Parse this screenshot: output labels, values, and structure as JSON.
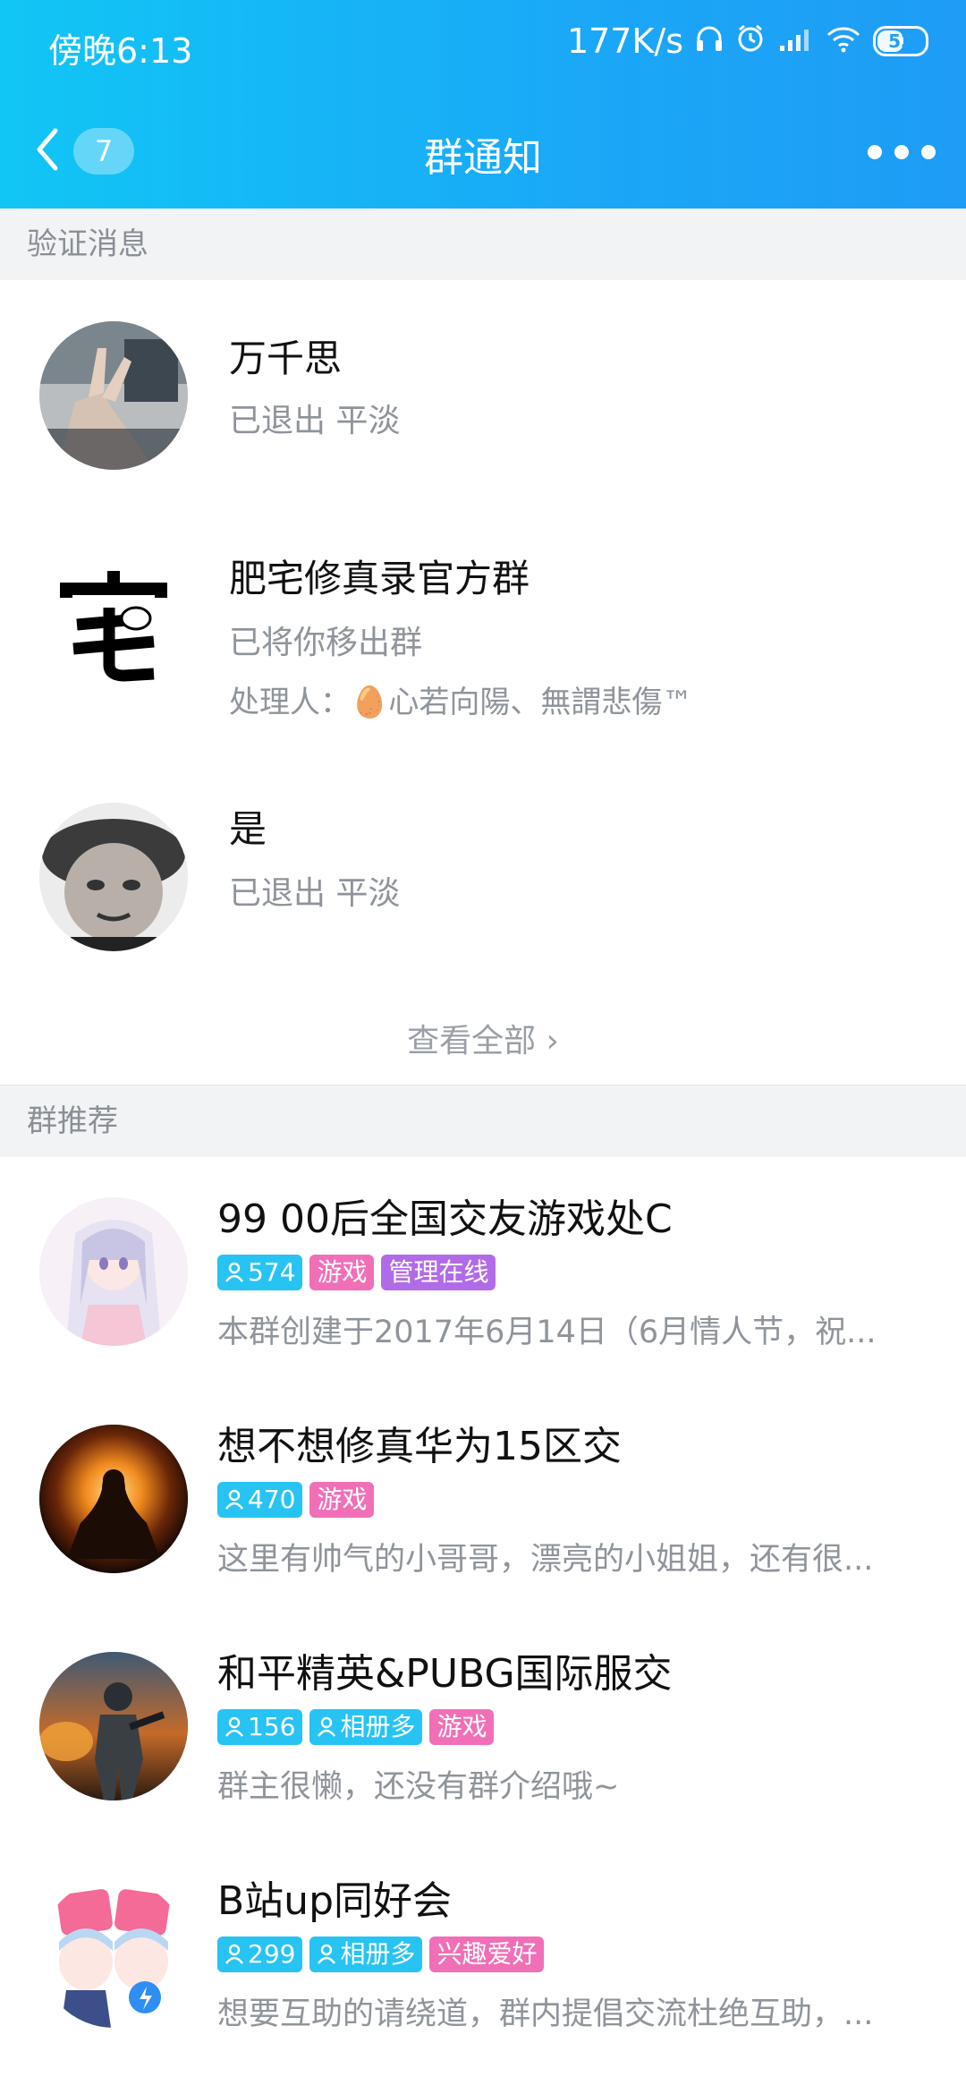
{
  "status": {
    "time": "傍晚6:13",
    "speed": "177K/s",
    "battery": "52"
  },
  "nav": {
    "back_count": "7",
    "title": "群通知"
  },
  "sections": {
    "verify": "验证消息",
    "recommend": "群推荐"
  },
  "notices": [
    {
      "title": "万千思",
      "line1": "已退出 平淡",
      "line2": ""
    },
    {
      "title": "肥宅修真录官方群",
      "line1": "已将你移出群",
      "line2": "处理人：🥚心若向陽、無謂悲傷™"
    },
    {
      "title": "是",
      "line1": "已退出 平淡",
      "line2": ""
    }
  ],
  "view_all": "查看全部 ›",
  "recommendations": [
    {
      "name": "99 00后全国交友游戏处C",
      "members": "574",
      "tags": [
        "游戏",
        "管理在线"
      ],
      "desc": "本群创建于2017年6月14日（6月情人节，祝..."
    },
    {
      "name": "想不想修真华为15区交",
      "members": "470",
      "tags": [
        "游戏"
      ],
      "desc": "这里有帅气的小哥哥，漂亮的小姐姐，还有很..."
    },
    {
      "name": "和平精英&PUBG国际服交",
      "members": "156",
      "tags": [
        "相册多",
        "游戏"
      ],
      "desc": "群主很懒，还没有群介绍哦~"
    },
    {
      "name": "B站up同好会",
      "members": "299",
      "tags": [
        "相册多",
        "兴趣爱好"
      ],
      "desc": "想要互助的请绕道，群内提倡交流杜绝互助，..."
    }
  ]
}
